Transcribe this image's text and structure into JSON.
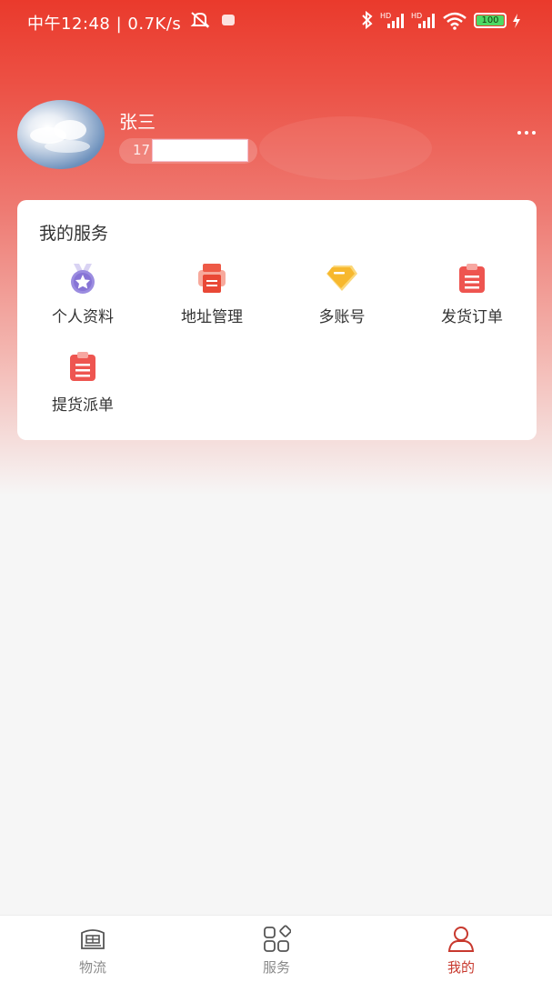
{
  "status_bar": {
    "time": "中午12:48",
    "speed": "0.7K/s",
    "battery": "100"
  },
  "profile": {
    "name": "张三",
    "phone_prefix": "17"
  },
  "services": {
    "title": "我的服务",
    "items": [
      {
        "label": "个人资料",
        "icon": "badge-star-icon"
      },
      {
        "label": "地址管理",
        "icon": "printer-icon"
      },
      {
        "label": "多账号",
        "icon": "diamond-icon"
      },
      {
        "label": "发货订单",
        "icon": "clipboard-icon"
      },
      {
        "label": "提货派单",
        "icon": "clipboard-icon"
      }
    ]
  },
  "tabbar": {
    "tabs": [
      {
        "label": "物流",
        "icon": "truck-icon"
      },
      {
        "label": "服务",
        "icon": "grid-icon"
      },
      {
        "label": "我的",
        "icon": "user-icon",
        "active": true
      }
    ]
  },
  "colors": {
    "header_red": "#ea3a2c",
    "active_tab": "#c8392e",
    "battery_green": "#4cd964"
  }
}
